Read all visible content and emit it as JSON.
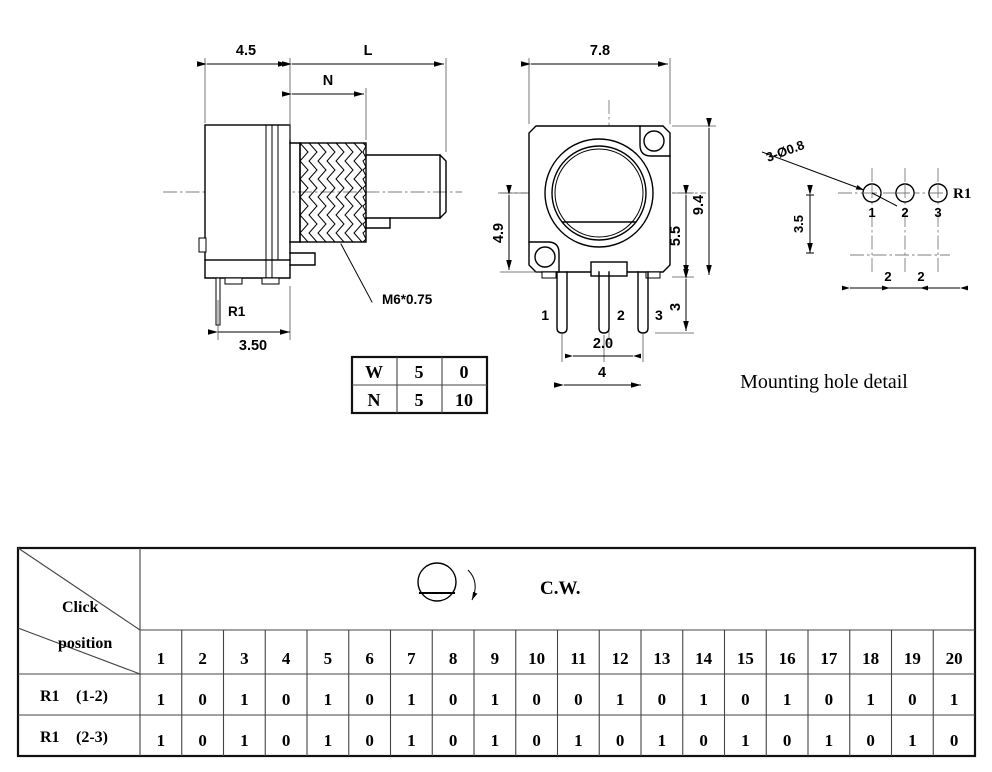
{
  "document": {
    "type": "mechanical-drawing",
    "subject": "Rotary potentiometer outline dimensions",
    "background_color": "#ffffff",
    "line_color": "#000000",
    "center_line_color": "#7d7d7d"
  },
  "side_view": {
    "name": "side-view",
    "dimensions": {
      "body_length": "4.5",
      "total_length": "L",
      "thread_length": "N",
      "pin_offset": "3.50"
    },
    "labels": {
      "thread_spec": "M6*0.75",
      "terminal": "R1"
    }
  },
  "front_view": {
    "name": "front-view",
    "dimensions": {
      "width": "7.8",
      "height_total": "9.4",
      "height_upper": "5.5",
      "height_left": "4.9",
      "pin_length": "3",
      "pin_pitch": "2.0",
      "pin_span": "4"
    },
    "pins": [
      "1",
      "2",
      "3"
    ]
  },
  "mounting_hole_detail": {
    "name": "mounting-hole-detail",
    "title": "Mounting hole detail",
    "hole_callout": "3-Ø0.8",
    "dimensions": {
      "vertical": "3.5",
      "pitch_1": "2",
      "pitch_2": "2"
    },
    "hole_labels": [
      "1",
      "2",
      "3"
    ],
    "reference_label": "R1"
  },
  "wn_table": {
    "name": "wn-table",
    "rows": [
      {
        "label": "W",
        "values": [
          "5",
          "0"
        ]
      },
      {
        "label": "N",
        "values": [
          "5",
          "10"
        ]
      }
    ]
  },
  "click_table": {
    "name": "click-position-table",
    "corner_label_line1": "Click",
    "corner_label_line2": "position",
    "rotation_label": "C.W.",
    "rotation_icon": "shaft-flat-circle-cw-arrow-icon",
    "positions": [
      "1",
      "2",
      "3",
      "4",
      "5",
      "6",
      "7",
      "8",
      "9",
      "10",
      "11",
      "12",
      "13",
      "14",
      "15",
      "16",
      "17",
      "18",
      "19",
      "20"
    ],
    "rows": [
      {
        "label_left": "R1",
        "label_right": "(1-2)",
        "values": [
          "1",
          "0",
          "1",
          "0",
          "1",
          "0",
          "1",
          "0",
          "1",
          "0",
          "0",
          "1",
          "0",
          "1",
          "0",
          "1",
          "0",
          "1",
          "0",
          "1"
        ]
      },
      {
        "label_left": "R1",
        "label_right": "(2-3)",
        "values": [
          "1",
          "0",
          "1",
          "0",
          "1",
          "0",
          "1",
          "0",
          "1",
          "0",
          "1",
          "0",
          "1",
          "0",
          "1",
          "0",
          "1",
          "0",
          "1",
          "0"
        ]
      }
    ]
  }
}
